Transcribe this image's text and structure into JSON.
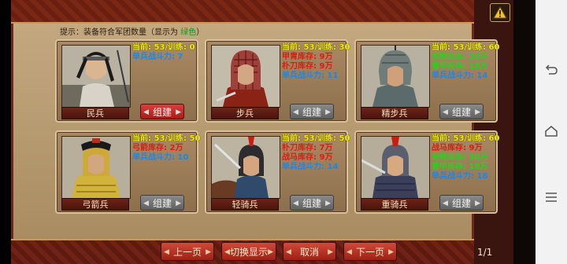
{
  "hint": {
    "prefix": "提示：装备符合军团数量（显示为 ",
    "green_word": "绿色",
    "suffix": "）"
  },
  "units": [
    {
      "name": "民兵",
      "lines": [
        {
          "text": "当前: 53/训练: 0",
          "color": "yellow"
        },
        {
          "text": "单兵战斗力: 7",
          "color": "blue"
        }
      ],
      "build": "组建",
      "active": true
    },
    {
      "name": "步兵",
      "lines": [
        {
          "text": "当前: 53/训练: 30",
          "color": "yellow"
        },
        {
          "text": "甲胄库存: 9万",
          "color": "red"
        },
        {
          "text": "朴刀库存: 9万",
          "color": "red"
        },
        {
          "text": "单兵战斗力: 11",
          "color": "blue"
        }
      ],
      "build": "组建",
      "active": false
    },
    {
      "name": "精步兵",
      "lines": [
        {
          "text": "当前: 53/训练: 60",
          "color": "yellow"
        },
        {
          "text": "长枪库存: 30万",
          "color": "green"
        },
        {
          "text": "重甲库存: 18万",
          "color": "green"
        },
        {
          "text": "单兵战斗力: 14",
          "color": "blue"
        }
      ],
      "build": "组建",
      "active": false
    },
    {
      "name": "弓箭兵",
      "lines": [
        {
          "text": "当前: 53/训练: 50",
          "color": "yellow"
        },
        {
          "text": "弓箭库存: 2万",
          "color": "red"
        },
        {
          "text": "单兵战斗力: 10",
          "color": "blue"
        }
      ],
      "build": "组建",
      "active": false
    },
    {
      "name": "轻骑兵",
      "lines": [
        {
          "text": "当前: 53/训练: 50",
          "color": "yellow"
        },
        {
          "text": "朴刀库存: 7万",
          "color": "red"
        },
        {
          "text": "战马库存: 9万",
          "color": "red"
        },
        {
          "text": "单兵战斗力: 14",
          "color": "blue"
        }
      ],
      "build": "组建",
      "active": false
    },
    {
      "name": "重骑兵",
      "lines": [
        {
          "text": "当前: 53/训练: 60",
          "color": "yellow"
        },
        {
          "text": "战马库存: 9万",
          "color": "red"
        },
        {
          "text": "长枪库存: 30万",
          "color": "green"
        },
        {
          "text": "重甲库存: 18万",
          "color": "green"
        },
        {
          "text": "单兵战斗力: 18",
          "color": "blue"
        }
      ],
      "build": "组建",
      "active": false
    }
  ],
  "buttons": {
    "prev": "上一页",
    "toggle": "切换显示",
    "cancel": "取消",
    "next": "下一页"
  },
  "page": "1/1",
  "icons": {
    "warning": "warning-icon",
    "nav_back": "back-icon",
    "nav_home": "home-icon",
    "nav_menu": "menu-icon"
  },
  "colors": {
    "yellow": "#f4f000",
    "red": "#e01a10",
    "green": "#27d21d",
    "blue": "#1e86e6",
    "build_active": "#c0322b",
    "build_inactive": "#7a7a7a"
  }
}
